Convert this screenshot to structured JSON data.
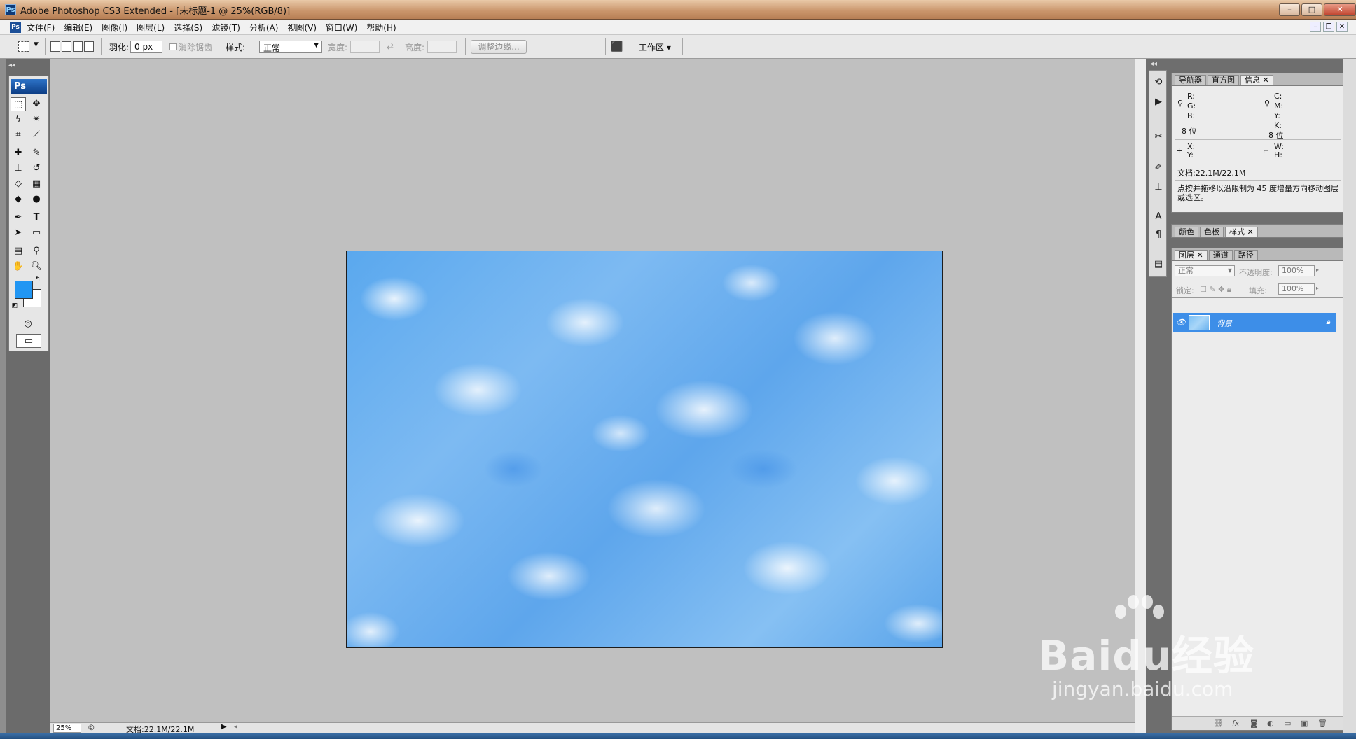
{
  "window": {
    "title": "Adobe Photoshop CS3 Extended - [未标题-1 @ 25%(RGB/8)]",
    "app_logo": "Ps"
  },
  "menu": {
    "items": [
      "文件(F)",
      "编辑(E)",
      "图像(I)",
      "图层(L)",
      "选择(S)",
      "滤镜(T)",
      "分析(A)",
      "视图(V)",
      "窗口(W)",
      "帮助(H)"
    ]
  },
  "options": {
    "feather_label": "羽化:",
    "feather_value": "0 px",
    "antialias_label": "消除锯齿",
    "style_label": "样式:",
    "style_value": "正常",
    "width_label": "宽度:",
    "height_label": "高度:",
    "refine_edge_button": "调整边缘...",
    "workspace_label": "工作区 ▾"
  },
  "toolbox": {
    "logo": "Ps",
    "foreground_color": "#2196f3",
    "background_color": "#ffffff"
  },
  "status": {
    "zoom": "25%",
    "doc_info": "文档:22.1M/22.1M"
  },
  "info_panel": {
    "tabs": [
      "导航器",
      "直方图",
      "信息"
    ],
    "active_tab": "信息",
    "rgb_labels": [
      "R:",
      "G:",
      "B:"
    ],
    "cmyk_labels": [
      "C:",
      "M:",
      "Y:",
      "K:"
    ],
    "bit_left": "8 位",
    "bit_right": "8 位",
    "xy_labels": [
      "X:",
      "Y:"
    ],
    "wh_labels": [
      "W:",
      "H:"
    ],
    "doc": "文档:22.1M/22.1M",
    "hint": "点按并拖移以沿限制为 45 度增量方向移动图层或选区。"
  },
  "color_panel": {
    "tabs": [
      "颜色",
      "色板",
      "样式"
    ],
    "active_tab": "样式"
  },
  "layers_panel": {
    "tabs": [
      "图层",
      "通道",
      "路径"
    ],
    "active_tab": "图层",
    "blend_mode": "正常",
    "opacity_label": "不透明度:",
    "opacity_value": "100%",
    "lock_label": "锁定:",
    "fill_label": "填充:",
    "fill_value": "100%",
    "layer_name": "背景"
  },
  "watermark": {
    "brand": "Baidu经验",
    "url": "jingyan.baidu.com"
  },
  "colors": {
    "canvas_blue": "#5aa8ee",
    "selection": "#3d8ee8"
  }
}
